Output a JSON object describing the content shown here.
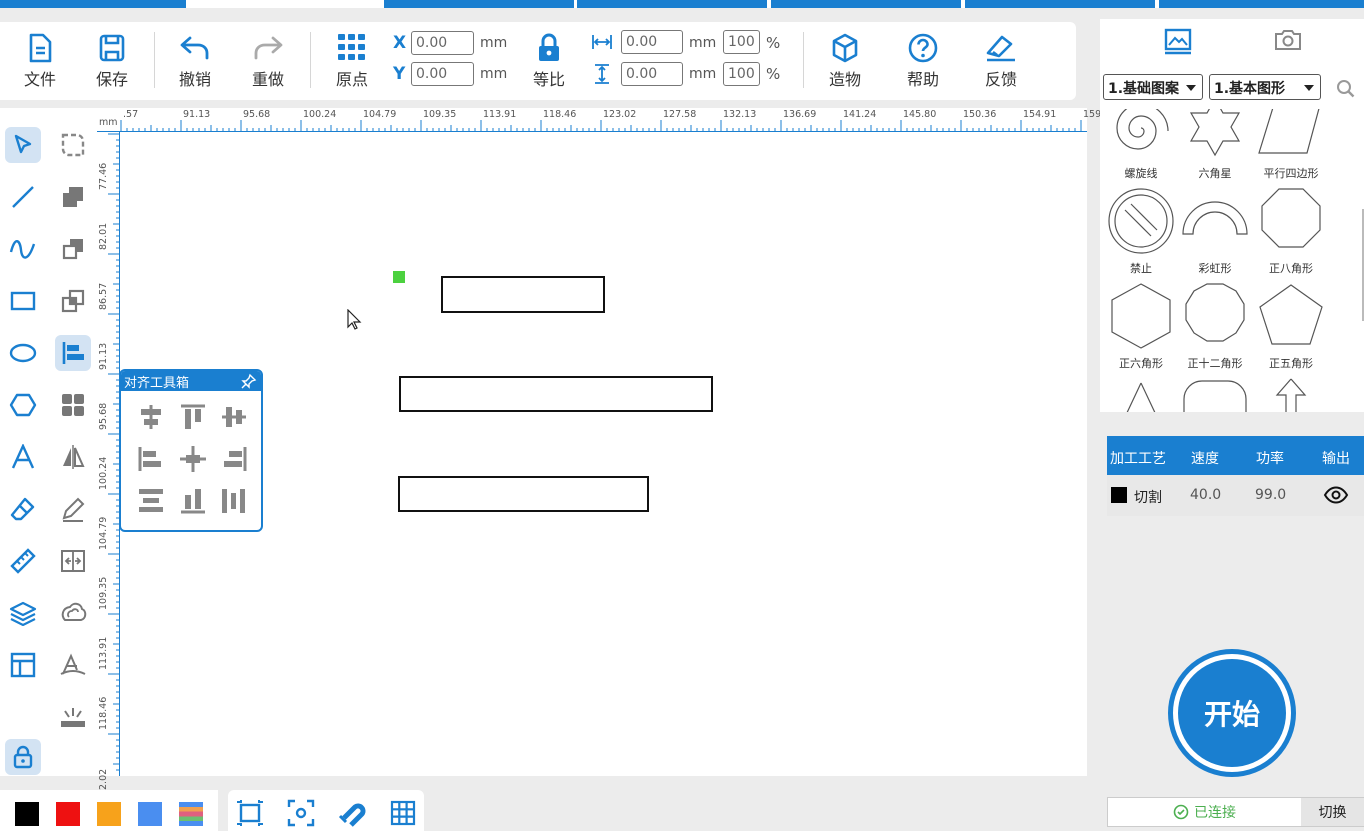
{
  "toolbar": {
    "file_label": "文件",
    "save_label": "保存",
    "undo_label": "撤销",
    "redo_label": "重做",
    "origin_label": "原点",
    "x_label": "X",
    "y_label": "Y",
    "x_value": "0.00",
    "y_value": "0.00",
    "unit_mm": "mm",
    "ratio_label": "等比",
    "width_value": "0.00",
    "height_value": "0.00",
    "width_pct": "100",
    "height_pct": "100",
    "percent": "%",
    "build_label": "造物",
    "help_label": "帮助",
    "feedback_label": "反馈"
  },
  "ruler": {
    "unit": "mm",
    "h_ticks": [
      ".57",
      "91.13",
      "95.68",
      "100.24",
      "104.79",
      "109.35",
      "113.91",
      "118.46",
      "123.02",
      "127.58",
      "132.13",
      "136.69",
      "141.24",
      "145.80",
      "150.36",
      "154.91",
      "159."
    ],
    "v_ticks": [
      "77.46",
      "82.01",
      "86.57",
      "91.13",
      "95.68",
      "100.24",
      "104.79",
      "109.35",
      "113.91",
      "118.46",
      "2.02"
    ]
  },
  "align_toolbox": {
    "title": "对齐工具箱"
  },
  "library": {
    "category1": "1.基础图案",
    "category2": "1.基本图形",
    "shapes": [
      "螺旋线",
      "六角星",
      "平行四边形",
      "禁止",
      "彩虹形",
      "正八角形",
      "正六角形",
      "正十二角形",
      "正五角形"
    ]
  },
  "layers": {
    "headers": [
      "加工工艺",
      "速度",
      "功率",
      "输出"
    ],
    "rows": [
      {
        "process": "切割",
        "speed": "40.0",
        "power": "99.0",
        "color": "#000000"
      }
    ]
  },
  "start_label": "开始",
  "status": {
    "connected": "已连接",
    "switch": "切换"
  },
  "colors": {
    "accent": "#1a7fd0",
    "swatches": [
      "#000000",
      "#ee1111",
      "#f7a21b",
      "#4a8ef0"
    ]
  }
}
